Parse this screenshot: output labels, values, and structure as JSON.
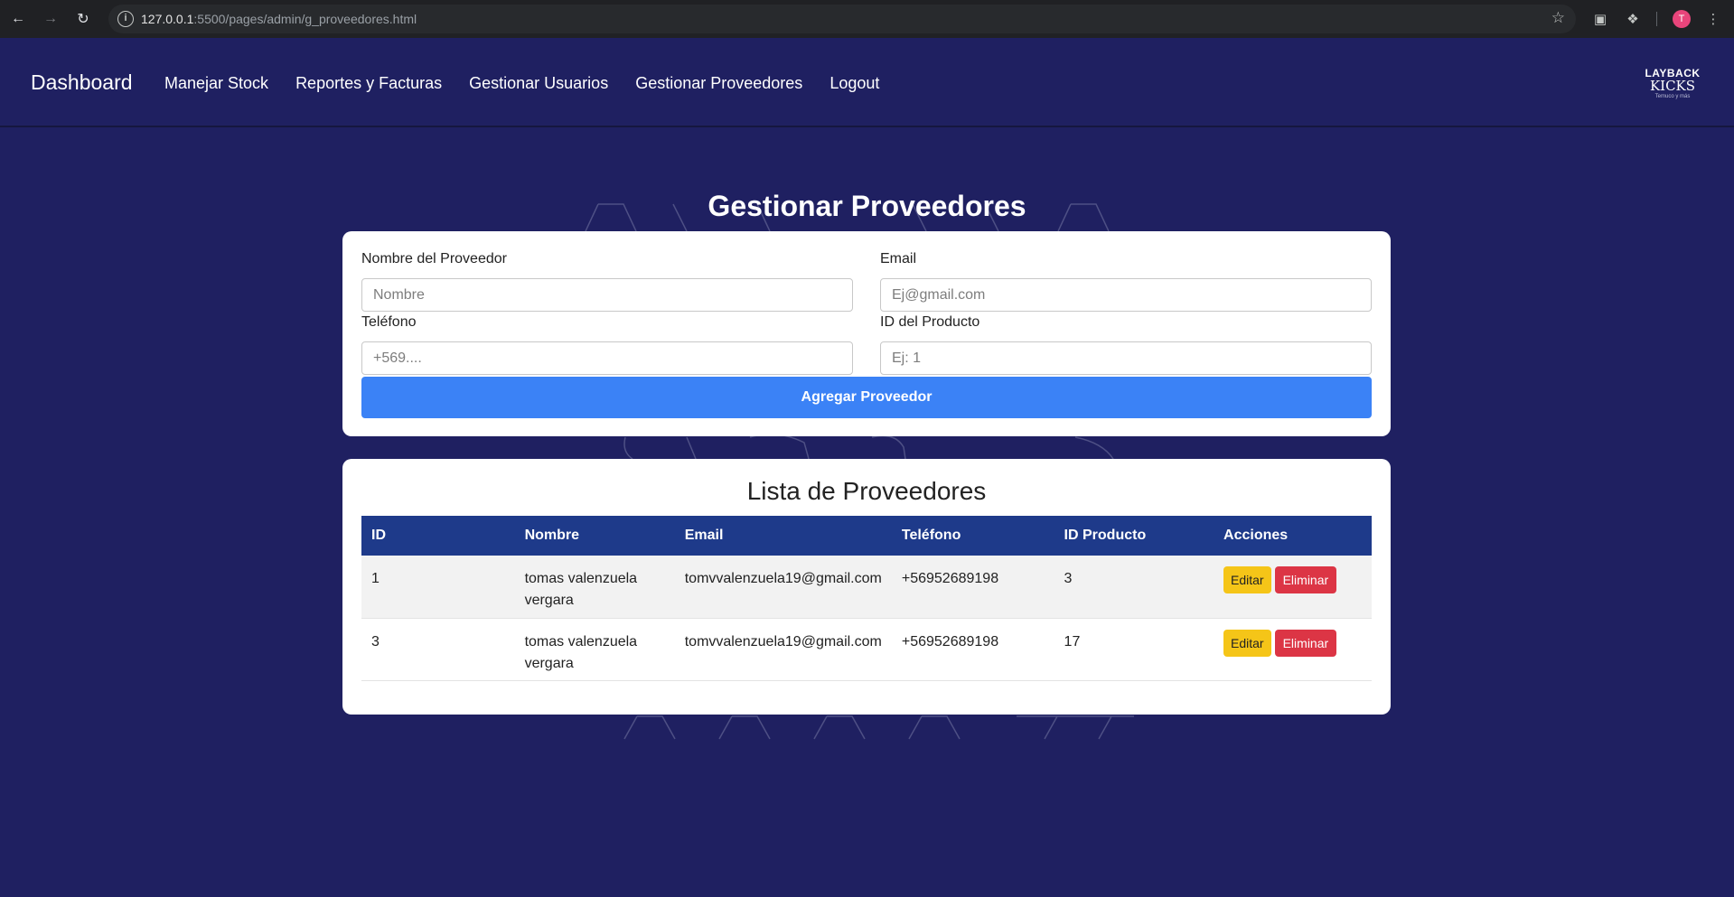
{
  "browser": {
    "url_host": "127.0.0.1",
    "url_path": ":5500/pages/admin/g_proveedores.html",
    "profile_initial": "T"
  },
  "navbar": {
    "brand": "Dashboard",
    "links": [
      "Manejar Stock",
      "Reportes y Facturas",
      "Gestionar Usuarios",
      "Gestionar Proveedores",
      "Logout"
    ],
    "logo": {
      "line1": "LAYBACK",
      "line2": "KICKS",
      "line3": "Temuco y más"
    }
  },
  "page": {
    "title": "Gestionar Proveedores"
  },
  "form": {
    "name_label": "Nombre del Proveedor",
    "name_placeholder": "Nombre",
    "email_label": "Email",
    "email_placeholder": "Ej@gmail.com",
    "phone_label": "Teléfono",
    "phone_placeholder": "+569....",
    "product_label": "ID del Producto",
    "product_placeholder": "Ej: 1",
    "submit_label": "Agregar Proveedor"
  },
  "list": {
    "title": "Lista de Proveedores",
    "headers": [
      "ID",
      "Nombre",
      "Email",
      "Teléfono",
      "ID Producto",
      "Acciones"
    ],
    "rows": [
      {
        "id": "1",
        "nombre": "tomas valenzuela vergara",
        "email": "tomvvalenzuela19@gmail.com",
        "telefono": "+56952689198",
        "id_producto": "3",
        "edit": "Editar",
        "delete": "Eliminar"
      },
      {
        "id": "3",
        "nombre": "tomas valenzuela vergara",
        "email": "tomvvalenzuela19@gmail.com",
        "telefono": "+56952689198",
        "id_producto": "17",
        "edit": "Editar",
        "delete": "Eliminar"
      }
    ]
  },
  "colors": {
    "background": "#1f2061",
    "primary_button": "#3b82f6",
    "table_header": "#1e3a8a",
    "edit_button": "#f5c518",
    "delete_button": "#dc3545"
  }
}
